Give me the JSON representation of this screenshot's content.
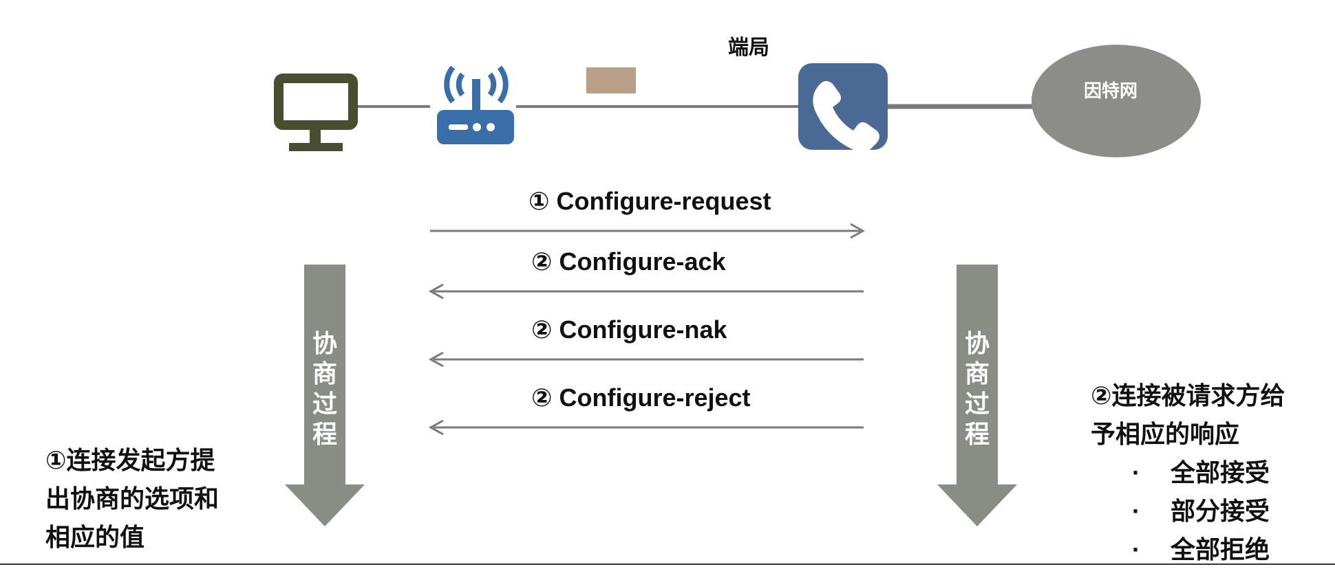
{
  "topology": {
    "end_office_label": "端局",
    "internet_label": "因特网"
  },
  "messages": [
    {
      "num": "①",
      "label": "Configure-request",
      "direction": "right"
    },
    {
      "num": "②",
      "label": "Configure-ack",
      "direction": "left"
    },
    {
      "num": "②",
      "label": "Configure-nak",
      "direction": "left"
    },
    {
      "num": "②",
      "label": "Configure-reject",
      "direction": "left"
    }
  ],
  "process": {
    "left_chars": [
      "协",
      "商",
      "过",
      "程"
    ],
    "right_chars": [
      "协",
      "商",
      "过",
      "程"
    ]
  },
  "notes": {
    "left_lines": [
      "①连接发起方提",
      "出协商的选项和",
      "相应的值"
    ],
    "right_lines": [
      "②连接被请求方给",
      "予相应的响应"
    ],
    "bullet_symbol": "·",
    "bullets": [
      "全部接受",
      "部分接受",
      "全部拒绝"
    ]
  },
  "colors": {
    "pc": "#4a4e30",
    "router": "#3a6ea8",
    "phone": "#4a6a95",
    "cloud": "#8c8c88",
    "link_block": "#b8a088",
    "line": "#7a7a7a",
    "process_arrow": "#8a8c86"
  }
}
